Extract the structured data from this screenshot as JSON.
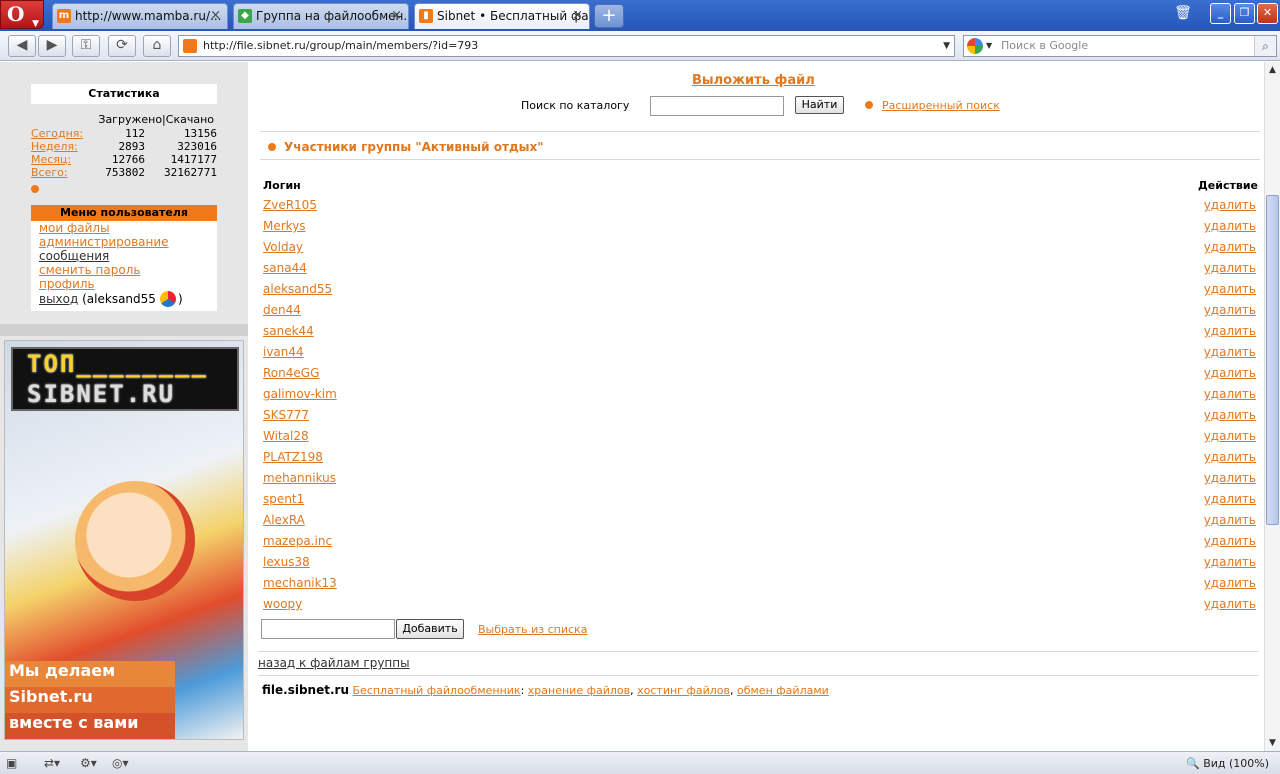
{
  "browser": {
    "tabs": [
      {
        "label": "http://www.mamba.ru/..."
      },
      {
        "label": "Группа на файлообмен..."
      },
      {
        "label": "Sibnet • Бесплатный фа..."
      }
    ],
    "address": "http://file.sibnet.ru/group/main/members/?id=793",
    "search_placeholder": "Поиск в Google",
    "zoom_label": "Вид (100%)"
  },
  "sidebar": {
    "stats_title": "Статистика",
    "stats_columns": "Загружено|Скачано",
    "stats_rows": [
      {
        "label": "Сегодня:",
        "uploaded": "112",
        "downloaded": "13156"
      },
      {
        "label": "Неделя:",
        "uploaded": "2893",
        "downloaded": "323016"
      },
      {
        "label": "Месяц:",
        "uploaded": "12766",
        "downloaded": "1417177"
      },
      {
        "label": "Всего:",
        "uploaded": "753802",
        "downloaded": "32162771"
      }
    ],
    "menu_title": "Меню пользователя",
    "menu_items": [
      "мои файлы",
      "администрирование",
      "сообщения",
      "сменить пароль",
      "профиль"
    ],
    "logout_label": "выход",
    "username": "(aleksand55",
    "username_close": ")",
    "banner": {
      "board_line1": "ТОП________",
      "board_line2": "SIBNET.RU",
      "caption1": "Мы делаем",
      "caption2": "Sibnet.ru",
      "caption3": "вместе с вами"
    }
  },
  "main": {
    "upload_link": "Выложить файл",
    "search_label": "Поиск по каталогу",
    "find_button": "Найти",
    "advanced_search": "Расширенный поиск",
    "group_title": "Участники группы \"Активный отдых\"",
    "col_login": "Логин",
    "col_action": "Действие",
    "delete_label": "удалить",
    "members": [
      "ZveR105",
      "Merkys",
      "Volday",
      "sana44",
      "aleksand55",
      "den44",
      "sanek44",
      "ivan44",
      "Ron4eGG",
      "galimov-kim",
      "SKS777",
      "Wital28",
      "PLATZ198",
      "mehannikus",
      "spent1",
      "AlexRA",
      "mazepa.inc",
      "lexus38",
      "mechanik13",
      "woopy"
    ],
    "add_button": "Добавить",
    "pick_from_list": "Выбрать из списка",
    "back_link": "назад к файлам группы",
    "footer": {
      "site": "file.sibnet.ru",
      "link1": "Бесплатный файлообменник",
      "colon": ":",
      "link2": "хранение файлов",
      "link3": "хостинг файлов",
      "link4": "обмен файлами",
      "sep": ","
    }
  }
}
